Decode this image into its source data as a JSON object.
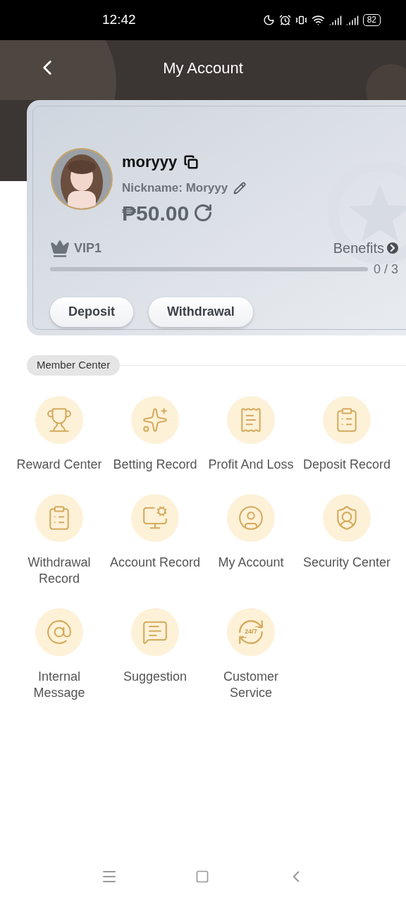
{
  "status_bar": {
    "time": "12:42",
    "battery": "82"
  },
  "header": {
    "title": "My Account"
  },
  "profile": {
    "username": "moryyy",
    "nickname": "Nickname: Moryyy",
    "balance": "₱50.00",
    "vip": "VIP1",
    "benefits": "Benefits",
    "progress_text": "0 / 3",
    "level": 0,
    "buttons": [
      "Deposit",
      "Withdrawal"
    ]
  },
  "member_center": {
    "title": "Member Center",
    "items": [
      {
        "kind": "trophy",
        "label": "Reward Center"
      },
      {
        "kind": "sparkle",
        "label": "Betting Record"
      },
      {
        "kind": "receipt",
        "label": "Profit And Loss"
      },
      {
        "kind": "upload",
        "label": "Deposit Record"
      },
      {
        "kind": "download",
        "label": "Withdrawal Record"
      },
      {
        "kind": "monitor",
        "label": "Account Record"
      },
      {
        "kind": "user",
        "label": "My Account"
      },
      {
        "kind": "shield",
        "label": "Security Center"
      },
      {
        "kind": "at",
        "label": "Internal Message"
      },
      {
        "kind": "chat",
        "label": "Suggestion"
      },
      {
        "kind": "clock",
        "label": "Customer Service",
        "icon_text": "24/7"
      }
    ]
  }
}
